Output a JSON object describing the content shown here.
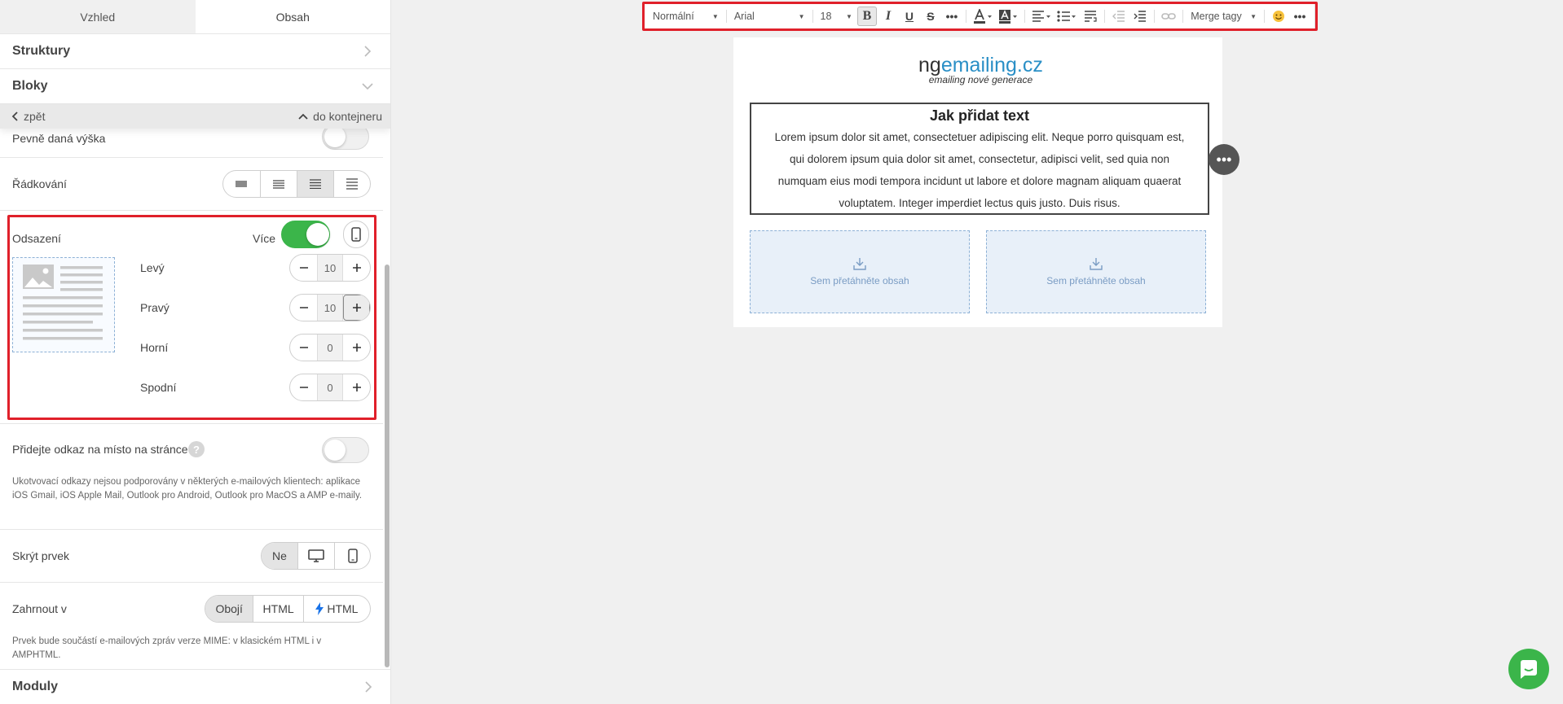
{
  "sidebar": {
    "tabs": [
      {
        "label": "Vzhled"
      },
      {
        "label": "Obsah"
      }
    ],
    "sections": {
      "struktury": "Struktury",
      "bloky": "Bloky",
      "moduly": "Moduly"
    },
    "back_label": "zpět",
    "container_label": "do kontejneru",
    "fixed_height": {
      "label": "Pevně daná výška",
      "on": false
    },
    "line_spacing": {
      "label": "Řádkování",
      "selected_index": 2
    },
    "padding": {
      "label": "Odsazení",
      "more_label": "Více",
      "more_on": true,
      "fields": [
        {
          "label": "Levý",
          "value": "10"
        },
        {
          "label": "Pravý",
          "value": "10"
        },
        {
          "label": "Horní",
          "value": "0"
        },
        {
          "label": "Spodní",
          "value": "0"
        }
      ]
    },
    "anchor": {
      "label": "Přidejte odkaz na místo na stránce",
      "help_icon": "?",
      "on": false,
      "note": "Ukotvovací odkazy nejsou podporovány v některých e-mailových klientech: aplikace iOS Gmail, iOS Apple Mail, Outlook pro Android, Outlook pro MacOS a AMP e-maily."
    },
    "hide": {
      "label": "Skrýt prvek",
      "options": [
        "Ne"
      ],
      "selected_index": 0
    },
    "include": {
      "label": "Zahrnout v",
      "options": [
        "Obojí",
        "HTML",
        "HTML"
      ],
      "selected_index": 0,
      "note": "Prvek bude součástí e-mailových zpráv verze MIME: v klasickém HTML i v AMPHTML."
    }
  },
  "toolbar": {
    "style": "Normální",
    "font": "Arial",
    "size": "18",
    "merge_tags": "Merge tagy"
  },
  "email": {
    "logo_main_a": "ng",
    "logo_main_b": "emailing.cz",
    "logo_sub": "emailing nové generace",
    "title": "Jak přidat text",
    "body": "Lorem ipsum dolor sit amet, consectetuer adipiscing elit. Neque porro quisquam est, qui dolorem ipsum quia dolor sit amet, consectetur, adipisci velit, sed quia non numquam eius modi tempora incidunt ut labore et dolore magnam aliquam quaerat voluptatem. Integer imperdiet lectus quis justo. Duis risus.",
    "drop_label": "Sem přetáhněte obsah"
  },
  "colors": {
    "accent_green": "#3bb54a",
    "highlight_red": "#e0202a",
    "link_blue": "#2a8fc6"
  }
}
